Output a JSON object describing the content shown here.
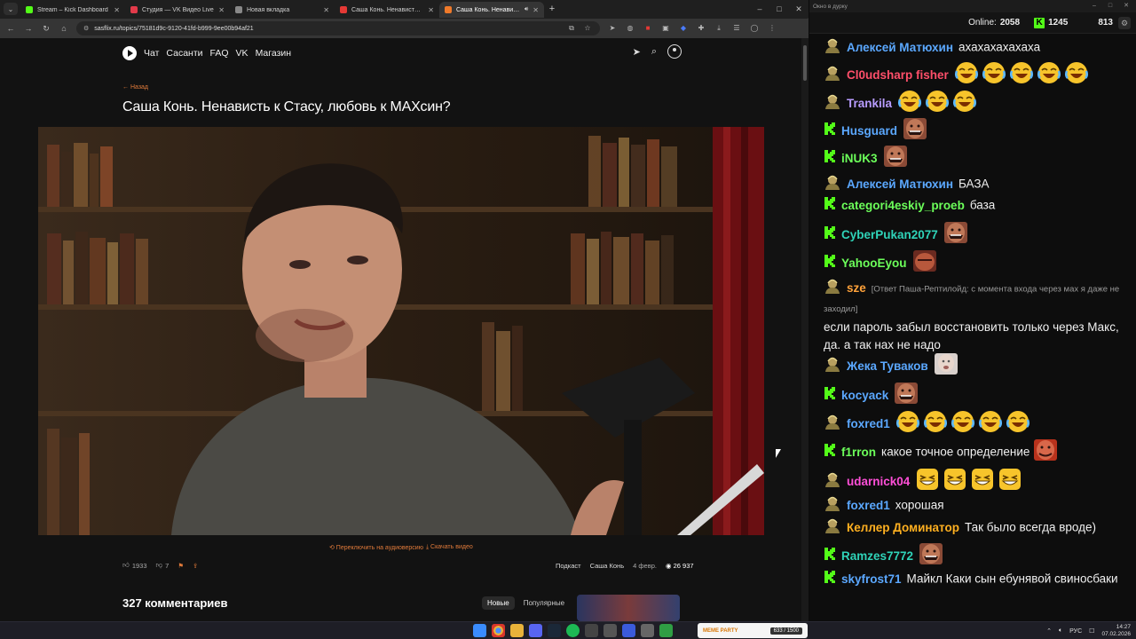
{
  "browser": {
    "tabs": [
      {
        "title": "Stream – Kick Dashboard",
        "color": "#53fc18"
      },
      {
        "title": "Студия — VK Видео Live",
        "color": "#e23a4a"
      },
      {
        "title": "Новая вкладка",
        "color": "#888888"
      },
      {
        "title": "Саша Конь. Ненависть к Стасу",
        "color": "#e53935"
      },
      {
        "title": "Саша Конь. Ненависть к С",
        "color": "#f07a2a",
        "active": true
      }
    ],
    "new_tab": "+",
    "url": "sasflix.ru/topics/75181d9c-9120-41fd-b999-9ee00b94af21",
    "window_controls": {
      "minimize": "–",
      "maximize": "□",
      "close": "✕"
    }
  },
  "site": {
    "nav": [
      "Чат",
      "Сасанти",
      "FAQ",
      "VK",
      "Магазин"
    ],
    "back": "← Назад",
    "title": "Саша Конь. Ненависть к Стасу, любовь к МАХсин?",
    "audio_switch": "⟲ Переключить на аудиоверсию",
    "download": "⤓ Скачать видео",
    "likes": "1933",
    "dislikes": "7",
    "tag1": "Подкаст",
    "tag2": "Саша Конь",
    "date": "4 февр.",
    "views": "26 937",
    "comments_count": "327 комментариев",
    "sort_new": "Новые",
    "sort_popular": "Популярные"
  },
  "chat": {
    "window_title": "Окно в дурку",
    "online_label": "Online:",
    "online": "2058",
    "kick_viewers": "1245",
    "vk_viewers": "813",
    "messages": [
      {
        "badge": "vk",
        "user": "Алексей Матюхин",
        "color": "#5ba8ff",
        "text": "ахахахахахаха",
        "emotes": []
      },
      {
        "badge": "vk",
        "user": "Cl0udsharp fisher",
        "color": "#ff4f6a",
        "text": "",
        "emotes": [
          "laugh",
          "laugh",
          "laugh",
          "laugh",
          "laugh"
        ]
      },
      {
        "badge": "vk",
        "user": "Trankila",
        "color": "#b89cff",
        "text": "",
        "emotes": [
          "laugh",
          "laugh",
          "laugh"
        ]
      },
      {
        "badge": "kick",
        "user": "Husguard",
        "color": "#5ba8ff",
        "text": "",
        "emotes": [
          "face"
        ]
      },
      {
        "badge": "kick",
        "user": "iNUK3",
        "color": "#6cff5a",
        "text": "",
        "emotes": [
          "face"
        ]
      },
      {
        "badge": "vk",
        "user": "Алексей Матюхин",
        "color": "#5ba8ff",
        "text": "БАЗА",
        "emotes": []
      },
      {
        "badge": "kick",
        "user": "categori4eskiy_proeb",
        "color": "#6cff5a",
        "text": "база",
        "emotes": []
      },
      {
        "badge": "kick",
        "user": "CyberPukan2077",
        "color": "#2fd3b8",
        "text": "",
        "emotes": [
          "face"
        ]
      },
      {
        "badge": "kick",
        "user": "YahooEyou",
        "color": "#6cff5a",
        "text": "",
        "emotes": [
          "face2"
        ]
      },
      {
        "badge": "vk",
        "user": "sze",
        "color": "#ffa23a",
        "reply": "[Ответ Паша-Рептилойд: с момента входа через мах я даже не заходил]",
        "text": "если пароль забыл восстановить только через Макс, да. а так нах не надо",
        "emotes": []
      },
      {
        "badge": "vk",
        "user": "Жека Туваков",
        "color": "#5ba8ff",
        "text": "",
        "emotes": [
          "pale"
        ]
      },
      {
        "badge": "kick",
        "user": "kocyack",
        "color": "#5ba8ff",
        "text": "",
        "emotes": [
          "face"
        ]
      },
      {
        "badge": "vk",
        "user": "foxred1",
        "color": "#5ba8ff",
        "text": "",
        "emotes": [
          "laugh",
          "laugh",
          "laugh",
          "laugh",
          "laugh"
        ]
      },
      {
        "badge": "kick",
        "user": "f1rron",
        "color": "#6cff5a",
        "text": "какое точное определение",
        "emotes": [
          "red"
        ]
      },
      {
        "badge": "vk",
        "user": "udarnick04",
        "color": "#ff4fd8",
        "text": "",
        "emotes": [
          "grin",
          "grin",
          "grin",
          "grin"
        ]
      },
      {
        "badge": "vk",
        "user": "foxred1",
        "color": "#5ba8ff",
        "text": "хорошая",
        "emotes": []
      },
      {
        "badge": "vk",
        "user": "Келлер Доминатор",
        "color": "#ffb020",
        "text": "Так было всегда вроде)",
        "emotes": []
      },
      {
        "badge": "kick",
        "user": "Ramzes7772",
        "color": "#2fd3b8",
        "text": "",
        "emotes": [
          "face"
        ]
      },
      {
        "badge": "kick",
        "user": "skyfrost71",
        "color": "#5ba8ff",
        "text": "Майкл Каки сын ебунявой свиносбаки",
        "emotes": []
      }
    ]
  },
  "taskbar": {
    "widget_title": "MEME PARTY",
    "widget_progress": "633 / 1500",
    "lang": "РУС",
    "time": "14:27",
    "date": "07.02.2026"
  }
}
